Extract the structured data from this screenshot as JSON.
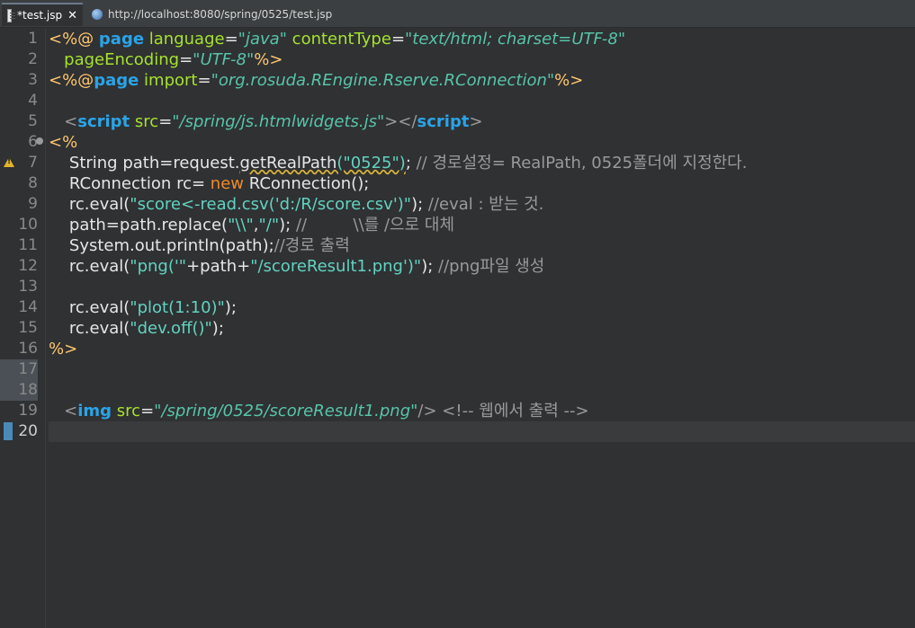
{
  "tabs": [
    {
      "label": "*test.jsp",
      "close": "✕"
    },
    {
      "label": "http://localhost:8080/spring/0525/test.jsp"
    }
  ],
  "line_numbers": [
    "1",
    "2",
    "3",
    "4",
    "5",
    "6",
    "7",
    "8",
    "9",
    "10",
    "11",
    "12",
    "13",
    "14",
    "15",
    "16",
    "17",
    "18",
    "19",
    "20"
  ],
  "code": {
    "l1": [
      "<%@ ",
      "page",
      " language",
      "=",
      "\"java\"",
      " contentType",
      "=",
      "\"text/html; charset=UTF-8\""
    ],
    "l2": [
      "   pageEncoding",
      "=",
      "\"UTF-8\"",
      "%>"
    ],
    "l3": [
      "<%@",
      "page",
      " import",
      "=",
      "\"org.rosuda.REngine.Rserve.RConnection\"",
      "%>"
    ],
    "l5": [
      "   <",
      "script",
      " src",
      "=",
      "\"/spring/js.htmlwidgets.js\"",
      "></",
      "script",
      ">"
    ],
    "l6": [
      "<%"
    ],
    "l7": [
      "    String path=request.",
      "getRealPath",
      "(\"0525\")",
      ";",
      " // 경로설정= RealPath, 0525폴더에 지정한다."
    ],
    "l8": [
      "    RConnection rc= ",
      "new",
      " RConnection();"
    ],
    "l9": [
      "    rc.eval(",
      "\"score<-read.csv('d:/R/score.csv')\"",
      "); ",
      "//eval : 받는 것."
    ],
    "l10": [
      "    path=path.replace(",
      "\"\\\\\"",
      ",",
      "\"/\"",
      "); ",
      "//         \\\\를 /으로 대체"
    ],
    "l11": [
      "    System.out.println(path);",
      "//경로 출력"
    ],
    "l12": [
      "    rc.eval(",
      "\"png('\"",
      "+path+",
      "\"/scoreResult1.png')\"",
      "); ",
      "//png파일 생성"
    ],
    "l14": [
      "    rc.eval(",
      "\"plot(1:10)\"",
      ");"
    ],
    "l15": [
      "    rc.eval(",
      "\"dev.off()\"",
      ");"
    ],
    "l16": [
      "%>"
    ],
    "l19": [
      "   <",
      "img",
      " src",
      "=",
      "\"/spring/0525/scoreResult1.png\"",
      "/>",
      " <!-- 웹에서 출력 -->"
    ]
  }
}
